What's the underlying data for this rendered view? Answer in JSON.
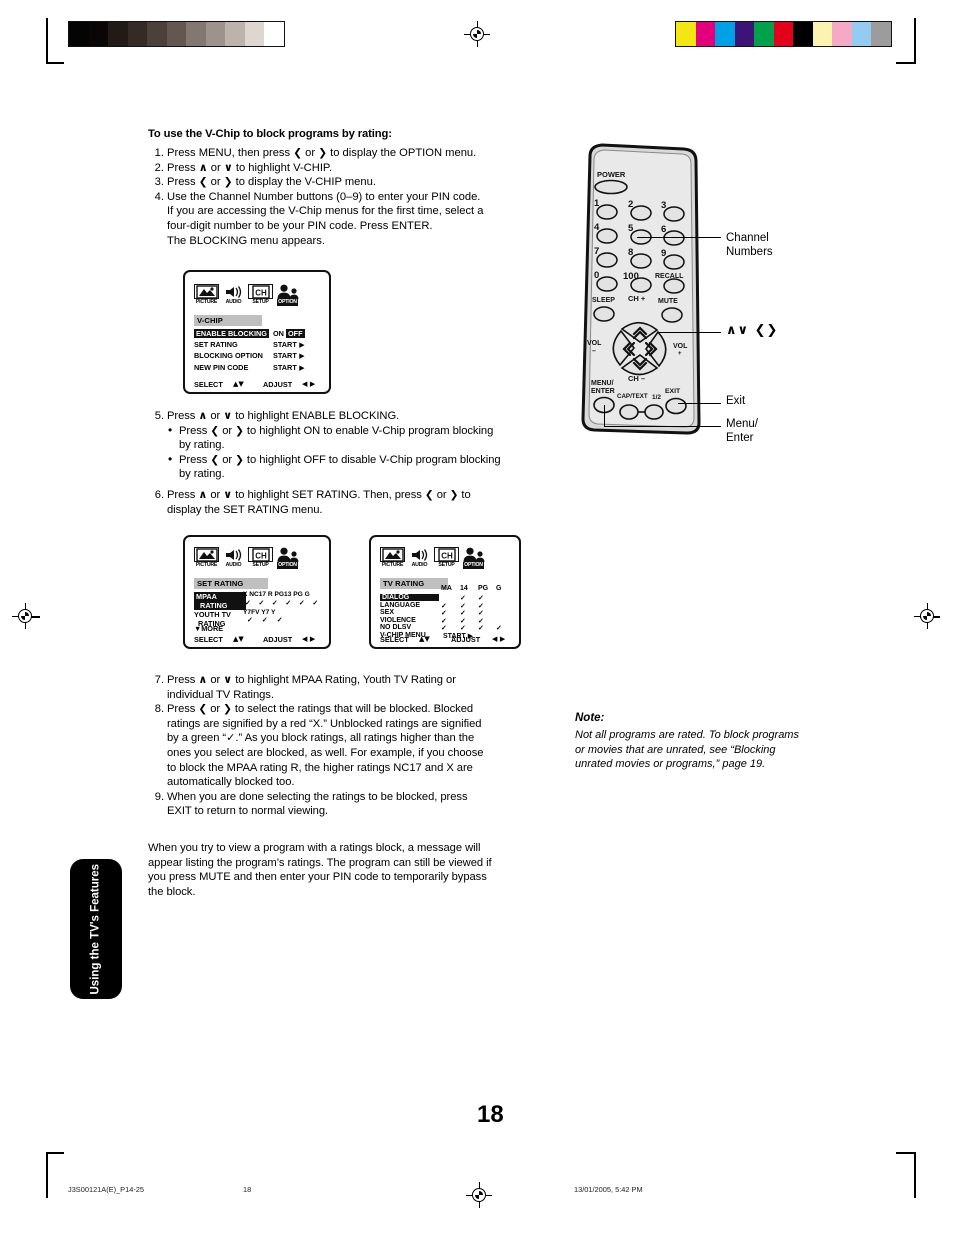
{
  "document": {
    "page_number": "18",
    "side_tab_label": "Using the TV's Features"
  },
  "top_marks": {
    "gray_bar_colors": [
      "#040404",
      "#0a0605",
      "#211a17",
      "#342b26",
      "#4b403a",
      "#635750",
      "#827871",
      "#9d938c",
      "#bcb3ab",
      "#ddd7cf",
      "#ffffff"
    ],
    "color_bar_colors": [
      "#f4e613",
      "#e2007d",
      "#00a0e4",
      "#3c1478",
      "#00a14b",
      "#e3001b",
      "#000000",
      "#fbf3b0",
      "#f5a9c4",
      "#93ccf0",
      "#9c9c9c"
    ]
  },
  "main": {
    "heading": "To use the V-Chip to block programs by rating:",
    "steps": [
      {
        "num": "1.",
        "parts": [
          {
            "t": "text",
            "v": "Press MENU, then press "
          },
          {
            "t": "icon",
            "v": "❮"
          },
          {
            "t": "text",
            "v": " or "
          },
          {
            "t": "icon",
            "v": "❯"
          },
          {
            "t": "text",
            "v": " to display the OPTION menu."
          }
        ]
      },
      {
        "num": "2.",
        "parts": [
          {
            "t": "text",
            "v": "Press "
          },
          {
            "t": "iconv",
            "v": "∧"
          },
          {
            "t": "text",
            "v": " or "
          },
          {
            "t": "iconv",
            "v": "∨"
          },
          {
            "t": "text",
            "v": " to highlight V-CHIP."
          }
        ]
      },
      {
        "num": "3.",
        "parts": [
          {
            "t": "text",
            "v": "Press "
          },
          {
            "t": "icon",
            "v": "❮"
          },
          {
            "t": "text",
            "v": " or "
          },
          {
            "t": "icon",
            "v": "❯"
          },
          {
            "t": "text",
            "v": "  to display the V-CHIP menu."
          }
        ]
      },
      {
        "num": "4.",
        "lines": [
          "Use the Channel Number buttons (0–9) to enter your PIN code.",
          "If you are accessing the V-Chip menus for the first time, select a",
          "four-digit number to be your PIN code. Press ENTER.",
          "The BLOCKING menu appears."
        ]
      }
    ],
    "step5": {
      "num": "5.",
      "lead": [
        "Press ",
        "∧",
        " or ",
        "∨",
        " to highlight ENABLE BLOCKING."
      ],
      "bullets": [
        [
          "Press ",
          "❮",
          " or ",
          "❯",
          " to highlight ON to enable V-Chip program blocking",
          "by rating."
        ],
        [
          "Press ",
          "❮",
          " or ",
          "❯",
          " to highlight OFF to disable V-Chip program blocking",
          "by rating."
        ]
      ]
    },
    "step6": {
      "num": "6.",
      "line1_a": "Press ",
      "line1_up": "∧",
      "line1_b": " or ",
      "line1_dn": "∨",
      "line1_c": "  to highlight SET RATING. Then, press ",
      "line1_lt": "❮",
      "line1_d": " or ",
      "line1_rt": "❯",
      "line1_e": " to",
      "line2": "display the SET RATING menu."
    },
    "step7": {
      "num": "7.",
      "a": "Press ",
      "up": "∧",
      "b": " or ",
      "dn": "∨",
      "c": " to highlight MPAA Rating, Youth TV Rating or",
      "line2": "individual TV Ratings."
    },
    "step8": {
      "num": "8.",
      "a": "Press ",
      "lt": "❮",
      "b": " or ",
      "rt": "❯",
      "c": " to select the ratings that will be blocked. Blocked",
      "lines": [
        "ratings are signified by a red “X.” Unblocked ratings are signified",
        "by a green “✓.” As you block ratings, all ratings higher than the",
        "ones you select are blocked, as well. For example, if you choose",
        "to block the MPAA rating R, the higher ratings NC17 and X are",
        "automatically blocked too."
      ]
    },
    "step9": {
      "num": "9.",
      "lines": [
        "When you are done selecting the ratings to be blocked, press",
        "EXIT to return to normal viewing."
      ]
    },
    "closing_paragraph": [
      "When you try to view a program with a ratings block, a message will",
      "appear listing the program’s ratings. The program can still be viewed if",
      "you press MUTE and then enter your PIN code to temporarily bypass",
      "the block."
    ]
  },
  "osd_icons": [
    {
      "name": "PICTURE",
      "selected": false
    },
    {
      "name": "AUDIO",
      "selected": false
    },
    {
      "name": "SETUP",
      "selected": false
    },
    {
      "name": "OPTION",
      "selected": true
    }
  ],
  "osd_vchip": {
    "title": "V-CHIP",
    "rows": [
      {
        "label": "ENABLE BLOCKING",
        "highlight": true,
        "value_plain": "ON ",
        "value_hl": "OFF",
        "arrow": false
      },
      {
        "label": "SET RATING",
        "highlight": false,
        "value_plain": "START",
        "value_hl": "",
        "arrow": true
      },
      {
        "label": "BLOCKING OPTION",
        "highlight": false,
        "value_plain": "START",
        "value_hl": "",
        "arrow": true
      },
      {
        "label": "NEW PIN CODE",
        "highlight": false,
        "value_plain": "START",
        "value_hl": "",
        "arrow": true
      }
    ],
    "footer_select": "SELECT",
    "footer_select_icons": "▲▼",
    "footer_adjust": "ADJUST",
    "footer_adjust_icons": "◀ ▶"
  },
  "osd_set_rating": {
    "title": "SET RATING",
    "mpaa_label_line1": "MPAA",
    "mpaa_label_line2": "RATING",
    "mpaa_columns": [
      "X",
      "NC17",
      "R",
      "PG13",
      "PG",
      "G"
    ],
    "mpaa_checks": [
      true,
      true,
      true,
      true,
      true,
      true
    ],
    "youth_label_line1": "YOUTH TV",
    "youth_label_line2": "RATING",
    "youth_columns": [
      "Y7FV",
      "Y7",
      "Y"
    ],
    "youth_checks": [
      true,
      true,
      true
    ],
    "more": "▼MORE",
    "footer_select": "SELECT",
    "footer_select_icons": "▲▼",
    "footer_adjust": "ADJUST",
    "footer_adjust_icons": "◀ ▶"
  },
  "osd_tv_rating": {
    "title": "TV RATING",
    "columns": [
      "MA",
      "14",
      "PG",
      "G"
    ],
    "rows": [
      {
        "label": "DIALOG",
        "highlight": true,
        "checks": [
          false,
          true,
          true,
          false
        ]
      },
      {
        "label": "LANGUAGE",
        "highlight": false,
        "checks": [
          true,
          true,
          true,
          false
        ]
      },
      {
        "label": "SEX",
        "highlight": false,
        "checks": [
          true,
          true,
          true,
          false
        ]
      },
      {
        "label": "VIOLENCE",
        "highlight": false,
        "checks": [
          true,
          true,
          true,
          false
        ]
      },
      {
        "label": "NO DLSV",
        "highlight": false,
        "checks": [
          true,
          true,
          true,
          true
        ]
      }
    ],
    "menu_row_label": "V-CHIP MENU",
    "menu_row_value": "START",
    "footer_select": "SELECT",
    "footer_select_icons": "▲▼",
    "footer_adjust": "ADJUST",
    "footer_adjust_icons": "◀ ▶"
  },
  "remote": {
    "power_label": "POWER",
    "number_keys": [
      "1",
      "2",
      "3",
      "4",
      "5",
      "6",
      "7",
      "8",
      "9",
      "0",
      "100"
    ],
    "recall_label": "RECALL",
    "sleep_label": "SLEEP",
    "mute_label": "MUTE",
    "ch_up_label": "CH +",
    "ch_down_label": "CH –",
    "vol_down_label": "VOL",
    "vol_down_sign": "–",
    "vol_up_label": "VOL",
    "vol_up_sign": "+",
    "menu_enter_label_1": "MENU/",
    "menu_enter_label_2": "ENTER",
    "captext_label": "CAP/TEXT",
    "half_label": "1/2",
    "exit_label": "EXIT"
  },
  "callouts": {
    "channel_numbers_l1": "Channel",
    "channel_numbers_l2": "Numbers",
    "dpad_icons": "∧∨  ❮❯",
    "exit": "Exit",
    "menu_enter_l1": "Menu/",
    "menu_enter_l2": "Enter"
  },
  "note": {
    "head": "Note:",
    "lines": [
      "Not all programs are rated. To block programs",
      "or movies that are unrated, see “Blocking",
      "unrated movies or programs,” page 19."
    ]
  },
  "footer": {
    "file": "J3S00121A(E)_P14-25",
    "page": "18",
    "timestamp": "13/01/2005, 5:42 PM"
  }
}
